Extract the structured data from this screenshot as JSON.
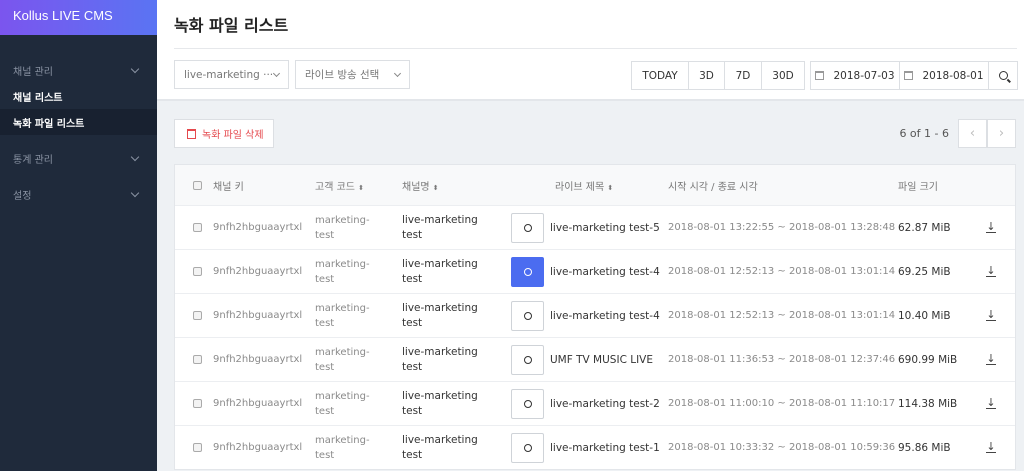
{
  "brand": "Kollus LIVE CMS",
  "sidebar": {
    "items": [
      {
        "label": "채널 관리",
        "type": "group"
      },
      {
        "label": "채널 리스트",
        "type": "sub"
      },
      {
        "label": "녹화 파일 리스트",
        "type": "sub",
        "active": true
      },
      {
        "label": "통계 관리",
        "type": "group"
      },
      {
        "label": "설정",
        "type": "group"
      }
    ]
  },
  "page_title": "녹화 파일 리스트",
  "filters": {
    "channel": "live-marketing ···",
    "broadcast": "라이브 방송 선택",
    "range_buttons": [
      "TODAY",
      "3D",
      "7D",
      "30D"
    ],
    "start_date": "2018-07-03",
    "end_date": "2018-08-01"
  },
  "delete_label": "녹화 파일 삭제",
  "pagination": {
    "text": "6 of 1 - 6",
    "prev": "‹",
    "next": "›"
  },
  "table": {
    "headers": {
      "key": "채널 키",
      "code": "고객 코드",
      "name": "채널명",
      "title": "라이브 제목",
      "time": "시작 시각 / 종료 시각",
      "size": "파일 크기"
    },
    "sort_icon": "⬍",
    "rows": [
      {
        "key": "9nfh2hbguaayrtxl",
        "code": "marketing-test",
        "name": "live-marketing test",
        "title": "live-marketing test-5",
        "time": "2018-08-01 13:22:55 ~ 2018-08-01 13:28:48",
        "size": "62.87 MiB"
      },
      {
        "key": "9nfh2hbguaayrtxl",
        "code": "marketing-test",
        "name": "live-marketing test",
        "title": "live-marketing test-4",
        "time": "2018-08-01 12:52:13 ~ 2018-08-01 13:01:14",
        "size": "69.25 MiB",
        "hover": true
      },
      {
        "key": "9nfh2hbguaayrtxl",
        "code": "marketing-test",
        "name": "live-marketing test",
        "title": "live-marketing test-4",
        "time": "2018-08-01 12:52:13 ~ 2018-08-01 13:01:14",
        "size": "10.40 MiB"
      },
      {
        "key": "9nfh2hbguaayrtxl",
        "code": "marketing-test",
        "name": "live-marketing test",
        "title": "UMF TV MUSIC LIVE",
        "time": "2018-08-01 11:36:53 ~ 2018-08-01 12:37:46",
        "size": "690.99 MiB"
      },
      {
        "key": "9nfh2hbguaayrtxl",
        "code": "marketing-test",
        "name": "live-marketing test",
        "title": "live-marketing test-2",
        "time": "2018-08-01 11:00:10 ~ 2018-08-01 11:10:17",
        "size": "114.38 MiB"
      },
      {
        "key": "9nfh2hbguaayrtxl",
        "code": "marketing-test",
        "name": "live-marketing test",
        "title": "live-marketing test-1",
        "time": "2018-08-01 10:33:32 ~ 2018-08-01 10:59:36",
        "size": "95.86 MiB"
      }
    ]
  }
}
